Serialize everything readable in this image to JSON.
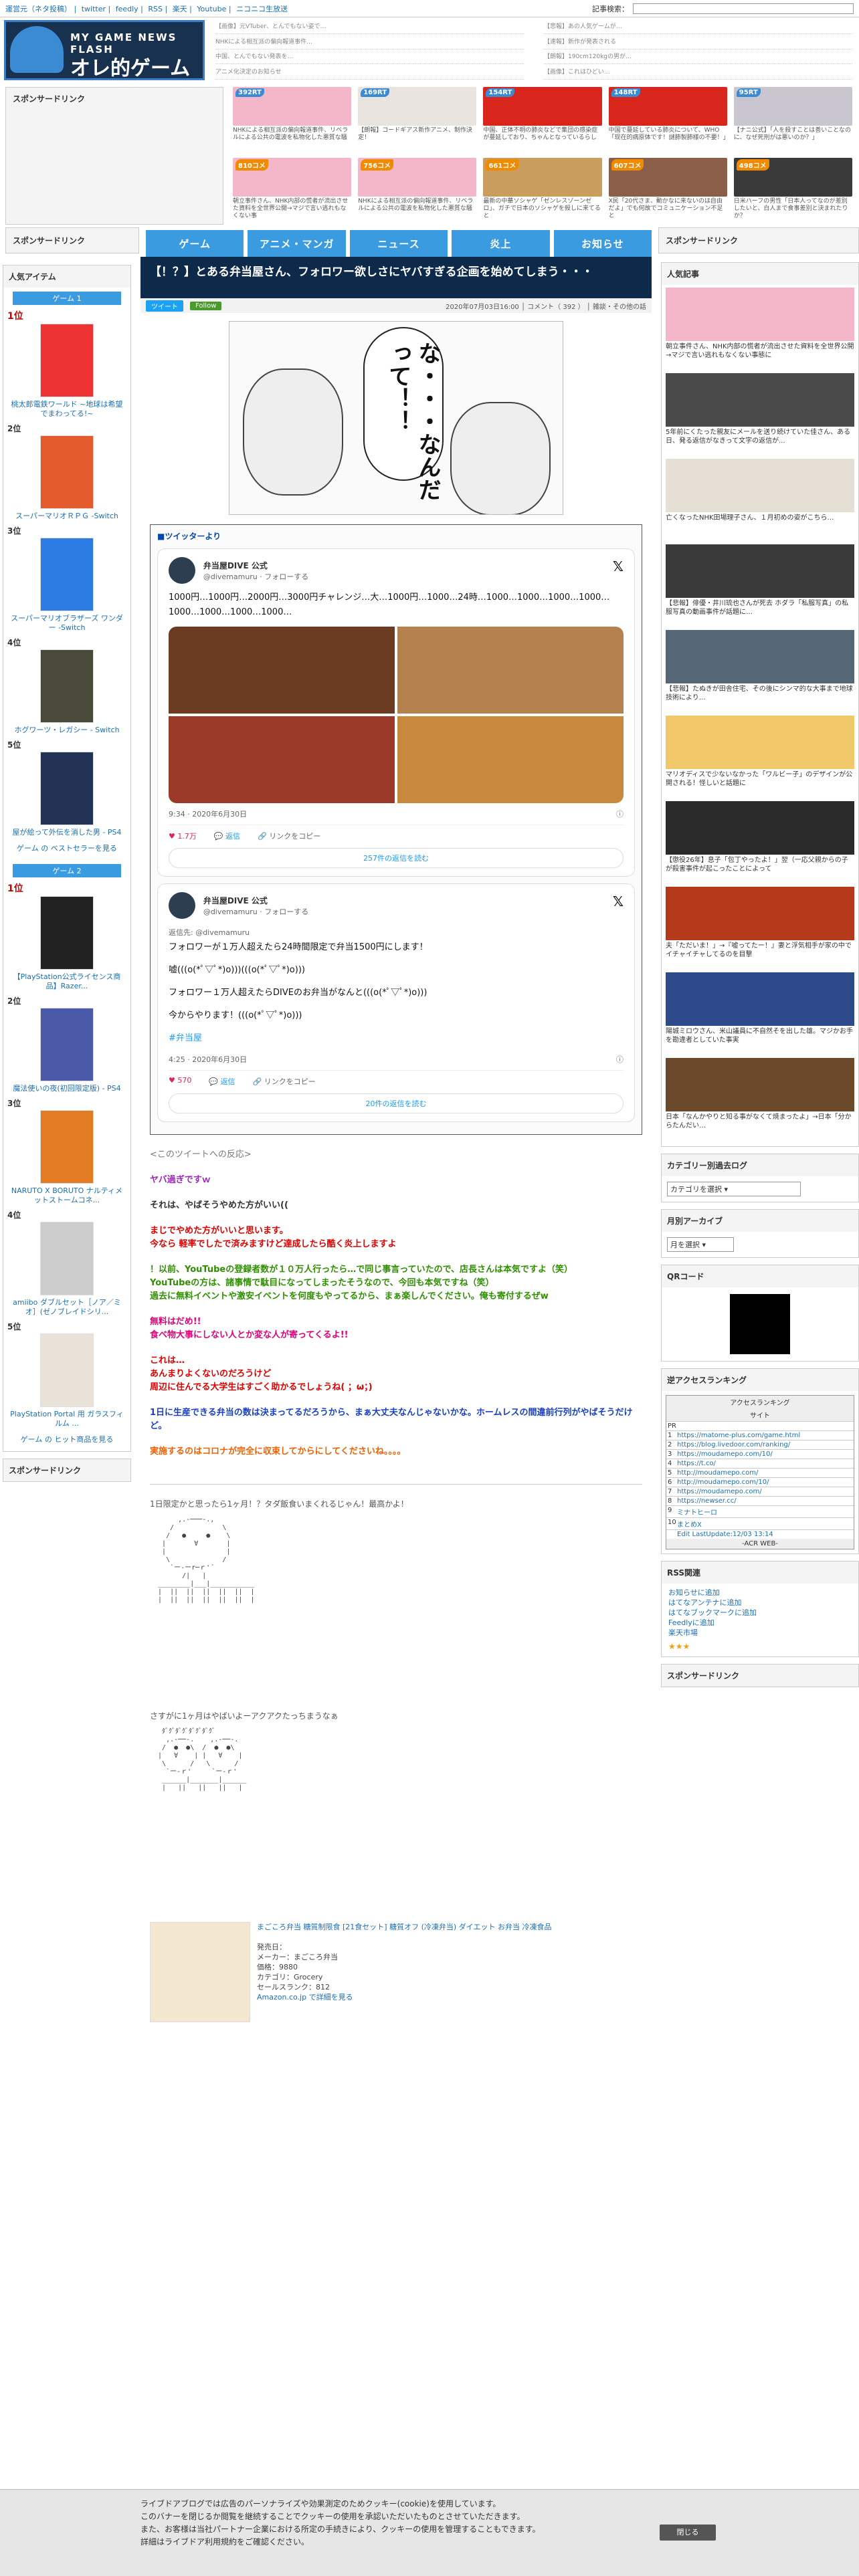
{
  "topbar": {
    "links": [
      "運営元（ネタ投稿）",
      "twitter",
      "feedly",
      "RSS",
      "楽天",
      "Youtube",
      "ニコニコ生放送"
    ],
    "search_label": "記事検索："
  },
  "logo": {
    "line1": "MY GAME NEWS FLASH",
    "line2": "オレ的ゲーム速報@JIN"
  },
  "header_rss": [
    "【画像】元VTuber、とんでもない姿で…",
    "【悲報】あの人気ゲームが…",
    "NHKによる相互派の偏向報道事件…",
    "【速報】新作が発表される",
    "中国、とんでもない発表を…",
    "【朗報】190cm120kgの男が…",
    "アニメ化決定のお知らせ",
    "【画像】これはひどい…"
  ],
  "sponsor_label": "スポンサードリンク",
  "thumbs": [
    {
      "badge": "392RT",
      "color": "#f4b7c9",
      "text": "NHKによる相互派の偏向報道事件、リベラルによる公共の電波を私物化した悪質な騒"
    },
    {
      "badge": "169RT",
      "color": "#e9e4df",
      "text": "【朗報】コードギアス新作アニメ、制作決定！"
    },
    {
      "badge": "154RT",
      "color": "#d9261c",
      "text": "中国、正体不明の肺炎などで集団の感染症が蔓延しており、ちゃんとなっているらし"
    },
    {
      "badge": "148RT",
      "color": "#d9261c",
      "text": "中国で蔓延している肺炎について、WHO「现在的病原体です！謎肺製肺様の不要！」"
    },
    {
      "badge": "95RT",
      "color": "#c9c6cf",
      "text": "【ナニ公式】「人を殺すことは善いことなのに、なぜ死刑がは悪いのか？」"
    },
    {
      "badge": "810コメ",
      "o": true,
      "color": "#f4b7c9",
      "text": "朝立事件さん、NHK内部の慌者が流出させた資料を全世界公開→マジで言い逃れもなくない事"
    },
    {
      "badge": "756コメ",
      "o": true,
      "color": "#f4b7c9",
      "text": "NHKによる相互派の偏向報道事件、リベラルによる公共の電波を私物化した悪質な騒"
    },
    {
      "badge": "661コメ",
      "o": true,
      "color": "#c99d5e",
      "text": "最新の中華ソシャゲ「ゼンレスゾーンゼロ」、ガチで日本のソシャゲを殺しに来てると"
    },
    {
      "badge": "607コメ",
      "o": true,
      "color": "#8b5e4a",
      "text": "X民「20代さま、動かなに来ないのは自由だよ」でも何故でコミュニケーション不足と"
    },
    {
      "badge": "498コメ",
      "o": true,
      "color": "#3a3a3a",
      "text": "日米ハーフの男性「日本人ってなのが差別したいと、白人まで食事差別と決まれたりか？"
    }
  ],
  "nav": [
    "ゲーム",
    "アニメ・マンガ",
    "ニュース",
    "炎上",
    "お知らせ"
  ],
  "left": {
    "popular_label": "人気アイテム",
    "game1": "ゲーム 1",
    "game1_items": [
      {
        "rank": "1位",
        "title": "桃太郎電鉄ワールド ~地球は希望でまわってる!~",
        "color": "#e33"
      },
      {
        "rank": "2位",
        "title": "スーパーマリオＲＰＧ -Switch",
        "color": "#e35a2c"
      },
      {
        "rank": "3位",
        "title": "スーパーマリオブラザーズ ワンダー -Switch",
        "color": "#2c7be3"
      },
      {
        "rank": "4位",
        "title": "ホグワーツ・レガシー - Switch",
        "color": "#4a4a3a"
      },
      {
        "rank": "5位",
        "title": "屋が絵って外伝を消した男 - PS4",
        "color": "#223355"
      }
    ],
    "game1_more": "ゲーム の ベストセラーを見る",
    "game2": "ゲーム 2",
    "game2_items": [
      {
        "rank": "1位",
        "title": "【PlayStation公式ライセンス商品】Razer...",
        "color": "#222"
      },
      {
        "rank": "2位",
        "title": "魔法使いの夜(初回限定版) - PS4",
        "color": "#4a5aa8"
      },
      {
        "rank": "3位",
        "title": "NARUTO X BORUTO ナルティメットストームコネ...",
        "color": "#e37b22"
      },
      {
        "rank": "4位",
        "title": "amiibo ダブルセット［ノア／ミオ］(ゼノブレイドシリ...",
        "color": "#ccc"
      },
      {
        "rank": "5位",
        "title": "PlayStation Portal 用 ガラスフィルム ...",
        "color": "#e8e2d8"
      }
    ],
    "game2_more": "ゲーム の ヒット商品を見る"
  },
  "article": {
    "title": "【！？】とある弁当屋さん、フォロワー欲しさにヤバすぎる企画を始めてしまう・・・",
    "tweet_btn": "ツイート",
    "follow_btn": "Follow",
    "meta": "2020年07月03日16:00 │ コメント（ 392 ） │ 雑談・その他の話",
    "manga_text": "な・・・なんだって！！",
    "twitter_head": "■ツイッターより",
    "tweets": [
      {
        "name": "弁当屋DIVE 公式",
        "handle": "@divemamuru · フォローする",
        "body": "1000円…1000円…2000円…3000円チャレンジ…大…1000円…1000…24時…1000…1000…1000…1000…1000…1000…1000…1000…",
        "time": "9:34 · 2020年6月30日",
        "likes": "1.7万",
        "reply": "返信",
        "copy": "リンクをコピー",
        "read": "257件の返信を読む",
        "photo_colors": [
          "#6b3b22",
          "#b5824f",
          "#9c3a2a",
          "#c8883e"
        ]
      },
      {
        "name": "弁当屋DIVE 公式",
        "handle": "@divemamuru · フォローする",
        "reply_to": "返信先: @divemamuru",
        "lines": [
          "フォロワーが１万人超えたら24時間限定で弁当1500円にします！",
          "嘘(((o(*ﾟ▽ﾟ*)o)))(((o(*ﾟ▽ﾟ*)o)))",
          "フォロワー１万人超えたらDIVEのお弁当がなんと(((o(*ﾟ▽ﾟ*)o)))",
          "今からやります！(((o(*ﾟ▽ﾟ*)o)))",
          "#弁当屋"
        ],
        "time": "4:25 · 2020年6月30日",
        "likes": "570",
        "reply": "返信",
        "copy": "リンクをコピー",
        "read": "20件の返信を読む"
      }
    ],
    "comments": [
      {
        "cls": "c-gray",
        "text": "<このツイートへの反応>"
      },
      {
        "cls": "c-pur",
        "text": "ヤバ過ぎですｗ"
      },
      {
        "cls": "",
        "text": "それは、やばそうやめた方がいい(("
      },
      {
        "cls": "c-red",
        "text": "まじでやめた方がいいと思います。\n今なら 軽率でしたで済みますけど達成したら酷く炎上しますよ"
      },
      {
        "cls": "c-grn",
        "text": "！以前、YouTubeの登録者数が１０万人行ったら…で同じ事言っていたので、店長さんは本気ですよ（笑）\nYouTubeの方は、諸事情で駄目になってしまったそうなので、今回も本気ですね（笑）\n過去に無料イベントや激安イベントを何度もやってるから、まぁ楽しんでください。俺も寄付するぜw"
      },
      {
        "cls": "c-mag",
        "text": "無料はだめ!!\n食べ物大事にしない人とか変な人が寄ってくるよ!!"
      },
      {
        "cls": "c-red",
        "text": "これは…\nあんまりよくないのだろうけど\n周辺に住んでる大学生はすごく助かるでしょうね( ；ω；)"
      },
      {
        "cls": "c-blu",
        "text": "1日に生産できる弁当の数は決まってるだろうから、まぁ大丈夫なんじゃないかな。ホームレスの間違前行列がやばそうだけど。"
      },
      {
        "cls": "c-org",
        "text": "実施するのはコロナが完全に収束してからにしてくださいね。。。。"
      }
    ],
    "aa1_caption": "1日限定かと思ったら1ヶ月！？タダ飯食いまくれるじゃん！最高かよ！",
    "aa2_caption": "さすがに1ヶ月はやばいよーアクアクたっちまうなぁ",
    "amazon": {
      "title": "まごころ弁当 糖質制限食 [21食セット] 糖質オフ (冷凍弁当) ダイエット お弁当 冷凍食品",
      "label_seller": "発売日：",
      "maker": "メーカー：まごころ弁当",
      "price": "価格：9880",
      "category": "カテゴリ：Grocery",
      "rank": "セールスランク：812",
      "link": "Amazon.co.jp で詳細を見る"
    }
  },
  "right": {
    "sponsor_label": "スポンサードリンク",
    "popular_label": "人気記事",
    "popular": [
      {
        "color": "#f4b7c9",
        "text": "朝立事件さん、NHK内部の慌者が流出させた資料を全世界公開→マジで言い逃れもなくない事態に"
      },
      {
        "color": "#4a4a4a",
        "text": "5年前にくたった親友にメールを送り続けていた佳さん、ある日、発る返信がなきって文字の返信が..."
      },
      {
        "color": "#e6dfd6",
        "text": "亡くなったNHK田場理子さん、１月初めの姿がこちら…"
      },
      {
        "color": "#3a3a3a",
        "text": "【悲報】俳優・井川琉也さんが死去 ホダラ「私服写真」の私服写真の動画事件が話題に…"
      },
      {
        "color": "#556677",
        "text": "【悲報】たぬきが田舎住宅、その後にシンマ的な大事まで地球技術により…"
      },
      {
        "color": "#f2c96a",
        "text": "マリオディスで少ないなかった「ワルビー子」のデザインが公開される！怪しいと話題に"
      },
      {
        "color": "#2a2a2a",
        "text": "【懲役26年】息子「包丁やったよ！」翌（一応父親からの子が殺害事件が起こったことによって"
      },
      {
        "color": "#b53a1c",
        "text": "夫「ただいま！」→『嘘ってたー！』妻と浮気相手が家の中でイチャイチャしてるのを目撃"
      },
      {
        "color": "#2d4a8a",
        "text": "陽城ミロウさん、米山議員に不自然そを出した雄。マジかお手を勘違者としていた事実"
      },
      {
        "color": "#6a4a2a",
        "text": "日本「なんかやりと知る事がなくて焼まったよ」→日本「分からたんだい…"
      }
    ],
    "category_label": "カテゴリー別過去ログ",
    "category_select": "カテゴリを選択",
    "archive_label": "月別アーカイブ",
    "archive_select": "月を選択",
    "qr_label": "QRコード",
    "access_label": "逆アクセスランキング",
    "access": {
      "title": "アクセスランキング",
      "site_col": "サイト",
      "rows": [
        {
          "n": "PR",
          "u": ""
        },
        {
          "n": "1",
          "u": "https://matome-plus.com/game.html"
        },
        {
          "n": "2",
          "u": "https://blog.livedoor.com/ranking/"
        },
        {
          "n": "3",
          "u": "https://moudamepo.com/10/"
        },
        {
          "n": "4",
          "u": "https://t.co/"
        },
        {
          "n": "5",
          "u": "http://moudamepo.com/"
        },
        {
          "n": "6",
          "u": "http://moudamepo.com/10/"
        },
        {
          "n": "7",
          "u": "https://moudamepo.com/"
        },
        {
          "n": "8",
          "u": "https://newser.cc/"
        },
        {
          "n": "9",
          "u": "ミナトヒーロ"
        },
        {
          "n": "10",
          "u": "まとめX"
        }
      ],
      "updated": "Edit LastUpdate:12/03 13:14",
      "foot": "-ACR WEB-"
    },
    "rss_label": "RSS関連",
    "rss_links": [
      "お知らせに追加",
      "はてなアンテナに追加",
      "はてなブックマークに追加",
      "Feedlyに追加",
      "楽天市場"
    ],
    "sponsor_label2": "スポンサードリンク"
  },
  "left_sponsor": "スポンサードリンク",
  "cookie": {
    "line1": "ライブドアブログでは広告のパーソナライズや効果測定のためクッキー(cookie)を使用しています。",
    "line2": "このバナーを閉じるか閲覧を継続することでクッキーの使用を承認いただいたものとさせていただきます。",
    "line3": "また、お客様は当社パートナー企業における所定の手続きにより、クッキーの使用を管理することもできます。",
    "line4": "詳細はライブドア利用規約をご確認ください。",
    "close": "閉じる"
  },
  "colors": {
    "accent": "#3b9be0",
    "title_bg": "#0e2a4a"
  }
}
